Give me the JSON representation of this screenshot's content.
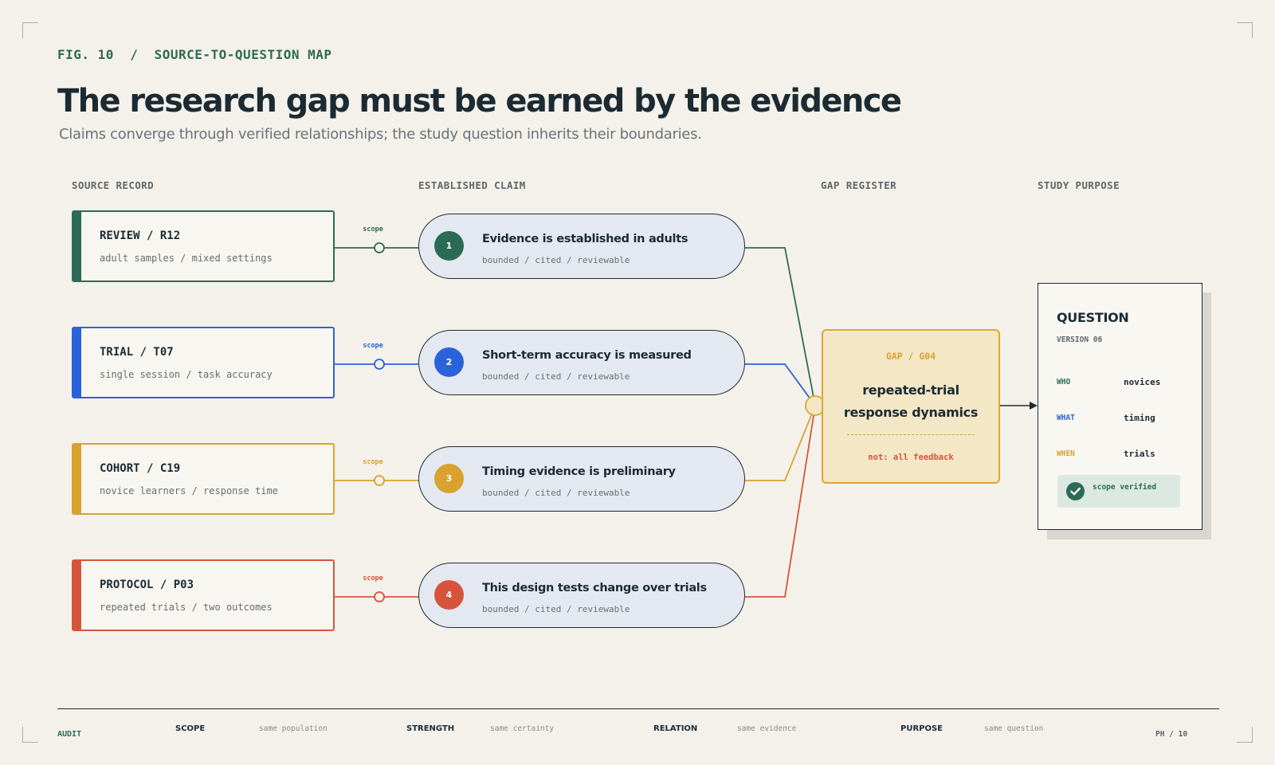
{
  "figure_label": "FIG. 10  /  SOURCE-TO-QUESTION MAP",
  "title": "The research gap must be earned by the evidence",
  "subtitle": "Claims converge through verified relationships; the study question inherits their boundaries.",
  "columns": {
    "source": "SOURCE RECORD",
    "claim": "ESTABLISHED CLAIM",
    "gap": "GAP REGISTER",
    "purpose": "STUDY PURPOSE"
  },
  "sources": [
    {
      "name": "REVIEW / R12",
      "detail": "adult samples / mixed settings",
      "color": "#2b6b55"
    },
    {
      "name": "TRIAL / T07",
      "detail": "single session / task accuracy",
      "color": "#2a63d9"
    },
    {
      "name": "COHORT / C19",
      "detail": "novice learners / response time",
      "color": "#d9a22e"
    },
    {
      "name": "PROTOCOL / P03",
      "detail": "repeated trials / two outcomes",
      "color": "#d7543c"
    }
  ],
  "link_label": "scope",
  "claims": [
    {
      "number": "1",
      "text": "Evidence is established in adults",
      "meta": "bounded / cited / reviewable"
    },
    {
      "number": "2",
      "text": "Short-term accuracy is measured",
      "meta": "bounded / cited / reviewable"
    },
    {
      "number": "3",
      "text": "Timing evidence is preliminary",
      "meta": "bounded / cited / reviewable"
    },
    {
      "number": "4",
      "text": "This design tests change over trials",
      "meta": "bounded / cited / reviewable"
    }
  ],
  "gap": {
    "id": "GAP / G04",
    "title_line1": "repeated-trial",
    "title_line2": "response dynamics",
    "note": "not: all feedback",
    "color": "#dea733"
  },
  "question": {
    "title": "QUESTION",
    "version": "VERSION 06",
    "rows": [
      {
        "key": "WHO",
        "value": "novices",
        "color": "#2b6b55"
      },
      {
        "key": "WHAT",
        "value": "timing",
        "color": "#2a63d9"
      },
      {
        "key": "WHEN",
        "value": "trials",
        "color": "#d9a22e"
      }
    ],
    "verified": "scope verified"
  },
  "footer": {
    "audit": "AUDIT",
    "items": [
      {
        "key": "SCOPE",
        "value": "same population"
      },
      {
        "key": "STRENGTH",
        "value": "same certainty"
      },
      {
        "key": "RELATION",
        "value": "same evidence"
      },
      {
        "key": "PURPOSE",
        "value": "same question"
      }
    ],
    "page": "PH / 10"
  }
}
